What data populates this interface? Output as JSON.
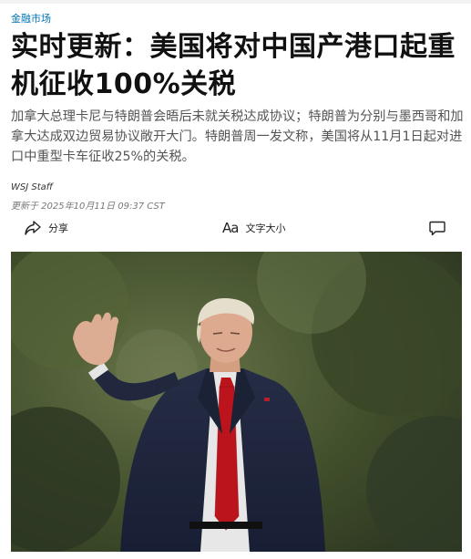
{
  "section": "金融市场",
  "headline": "实时更新：美国将对中国产港口起重机征收100%关税",
  "dek": "加拿大总理卡尼与特朗普会晤后未就关税达成协议；特朗普为分别与墨西哥和加拿大达成双边贸易协议敞开大门。特朗普周一发文称，美国将从11月1日起对进口中重型卡车征收25%的关税。",
  "byline": {
    "author": "WSJ Staff",
    "timestamp": "更新于 2025年10月11日 09:37 CST"
  },
  "toolbar": {
    "share_label": "分享",
    "textsize_icon": "Aa",
    "textsize_label": "文字大小",
    "share_icon": "share-arrow-icon",
    "comment_icon": "comment-bubble-icon"
  },
  "colors": {
    "section_link": "#0274b6",
    "headline": "#111111",
    "dek": "#555555"
  }
}
